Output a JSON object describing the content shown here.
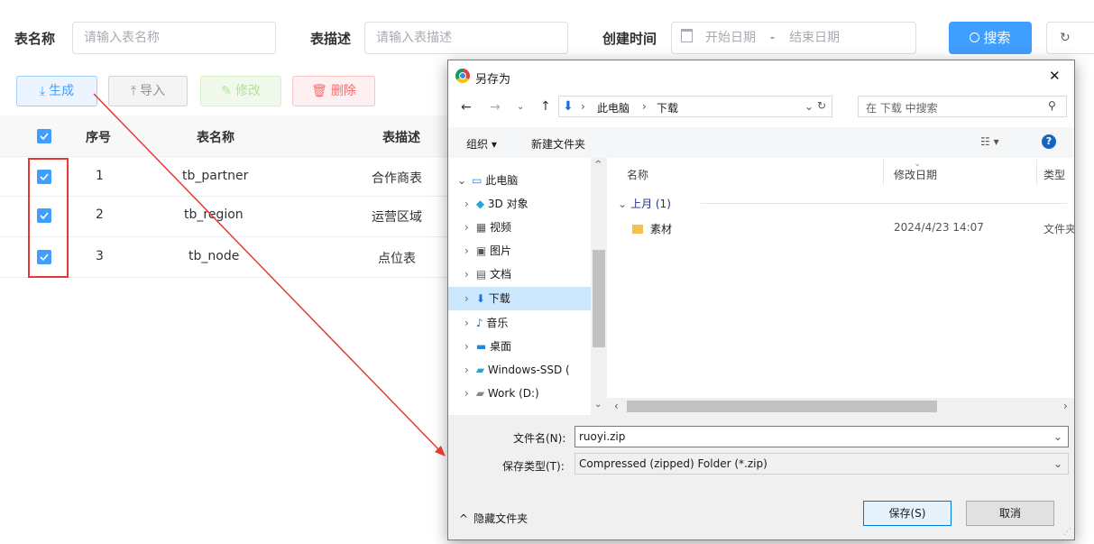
{
  "search": {
    "table_name_label": "表名称",
    "table_name_placeholder": "请输入表名称",
    "table_desc_label": "表描述",
    "table_desc_placeholder": "请输入表描述",
    "created_label": "创建时间",
    "start_date_placeholder": "开始日期",
    "date_sep": "-",
    "end_date_placeholder": "结束日期",
    "search_button": "搜索"
  },
  "toolbar": {
    "generate": "生成",
    "import": "导入",
    "modify": "修改",
    "delete": "删除"
  },
  "table": {
    "headers": [
      "序号",
      "表名称",
      "表描述"
    ],
    "rows": [
      {
        "index": "1",
        "name": "tb_partner",
        "desc": "合作商表"
      },
      {
        "index": "2",
        "name": "tb_region",
        "desc": "运营区域"
      },
      {
        "index": "3",
        "name": "tb_node",
        "desc": "点位表"
      }
    ]
  },
  "dialog": {
    "title": "另存为",
    "close": "✕",
    "breadcrumb": [
      "此电脑",
      "下载"
    ],
    "search_placeholder": "在 下载 中搜索",
    "organize": "组织 ▾",
    "new_folder": "新建文件夹",
    "columns": {
      "name": "名称",
      "modified": "修改日期",
      "type": "类型"
    },
    "group": "上月 (1)",
    "files": [
      {
        "name": "素材",
        "modified": "2024/4/23 14:07",
        "type": "文件夹"
      }
    ],
    "tree": {
      "root": "此电脑",
      "items": [
        "3D 对象",
        "视频",
        "图片",
        "文档",
        "下载",
        "音乐",
        "桌面",
        "Windows-SSD (",
        "Work (D:)"
      ]
    },
    "filename_label": "文件名(N):",
    "filename_value": "ruoyi.zip",
    "filetype_label": "保存类型(T):",
    "filetype_value": "Compressed (zipped) Folder (*.zip)",
    "hide_folders": "隐藏文件夹",
    "save": "保存(S)",
    "cancel": "取消"
  },
  "colors": {
    "primary": "#409eff",
    "annotation": "#e53935"
  }
}
